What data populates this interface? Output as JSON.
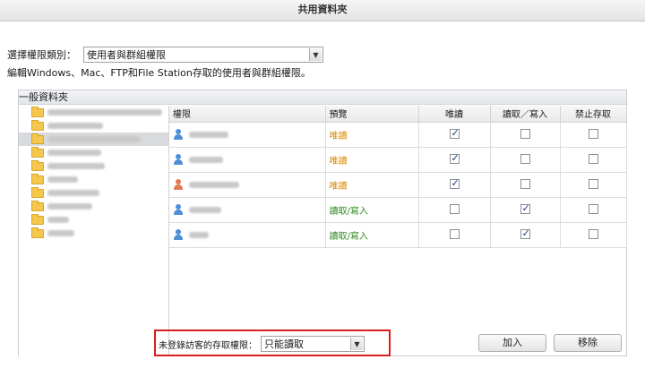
{
  "window": {
    "title": "共用資料夾"
  },
  "permission_type": {
    "label": "選擇權限類別：",
    "value": "使用者與群組權限"
  },
  "description": "編輯Windows、Mac、FTP和File Station存取的使用者與群組權限。",
  "panel": {
    "title": "一般資料夾"
  },
  "folders": [
    {
      "selected": false
    },
    {
      "selected": false
    },
    {
      "selected": true
    },
    {
      "selected": false
    },
    {
      "selected": false
    },
    {
      "selected": false
    },
    {
      "selected": false
    },
    {
      "selected": false
    },
    {
      "selected": false
    },
    {
      "selected": false
    }
  ],
  "table": {
    "headers": {
      "permission": "權限",
      "preview": "預覽",
      "read_only": "唯讀",
      "read_write": "讀取／寫入",
      "deny": "禁止存取"
    },
    "rows": [
      {
        "icon": "user-icon",
        "preview": "唯讀",
        "preview_type": "ro",
        "read_only": true,
        "read_write": false,
        "deny": false
      },
      {
        "icon": "user-icon",
        "preview": "唯讀",
        "preview_type": "ro",
        "read_only": true,
        "read_write": false,
        "deny": false
      },
      {
        "icon": "admin-user-icon",
        "preview": "唯讀",
        "preview_type": "ro",
        "read_only": true,
        "read_write": false,
        "deny": false
      },
      {
        "icon": "user-icon",
        "preview": "讀取/寫入",
        "preview_type": "rw",
        "read_only": false,
        "read_write": true,
        "deny": false
      },
      {
        "icon": "user-icon",
        "preview": "讀取/寫入",
        "preview_type": "rw",
        "read_only": false,
        "read_write": true,
        "deny": false
      }
    ]
  },
  "guest": {
    "label": "未登錄訪客的存取權限：",
    "value": "只能讀取"
  },
  "buttons": {
    "add": "加入",
    "remove": "移除"
  },
  "colors": {
    "highlight": "#d62020",
    "read_only": "#d88c00",
    "read_write": "#2f8a1f"
  }
}
